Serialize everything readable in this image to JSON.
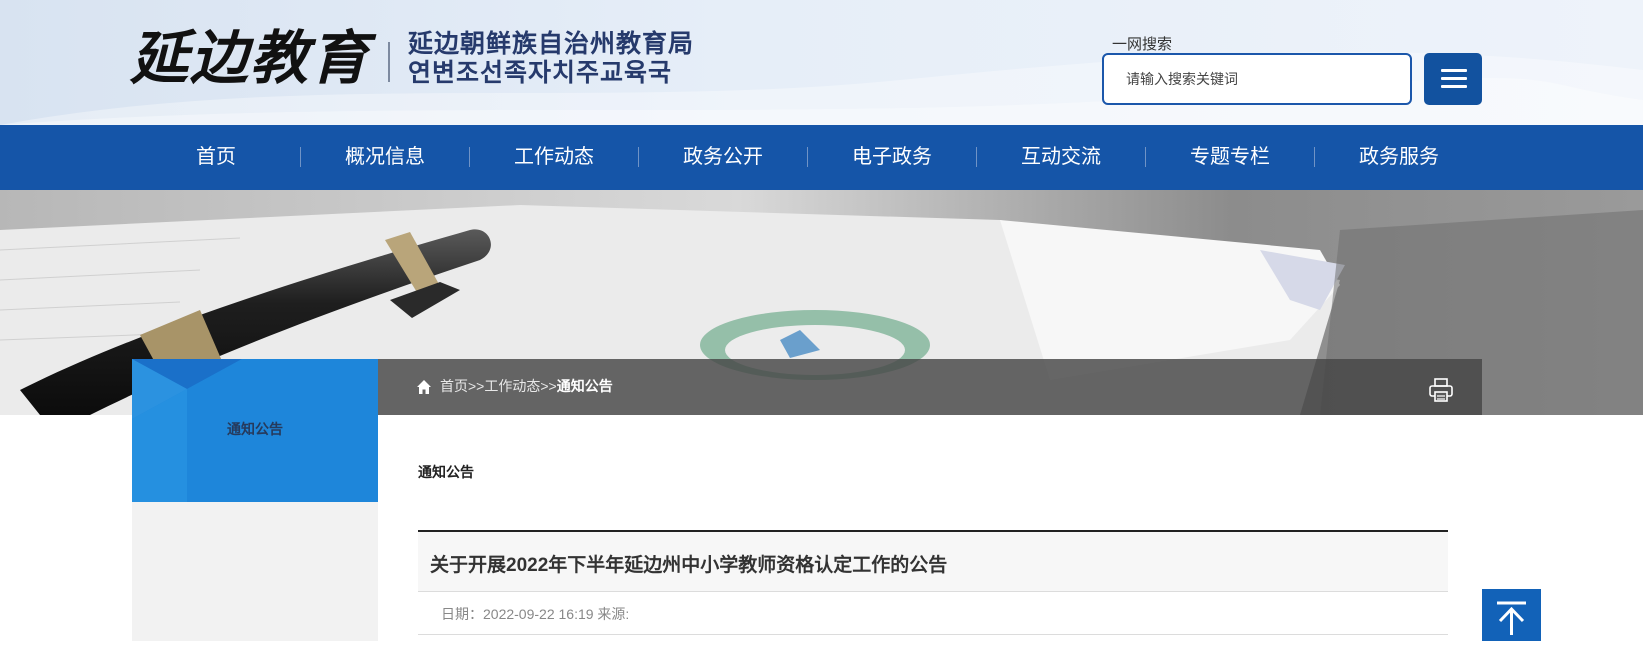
{
  "header": {
    "logo_calligraphy": "延边教育",
    "logo_org_cn": "延边朝鲜族自治州教育局",
    "logo_org_kr": "연변조선족자치주교육국",
    "search_label": "一网搜索",
    "search_placeholder": "请输入搜索关键词"
  },
  "nav": {
    "items": [
      {
        "label": "首页"
      },
      {
        "label": "概况信息"
      },
      {
        "label": "工作动态"
      },
      {
        "label": "政务公开"
      },
      {
        "label": "电子政务"
      },
      {
        "label": "互动交流"
      },
      {
        "label": "专题专栏"
      },
      {
        "label": "政务服务"
      }
    ]
  },
  "breadcrumb": {
    "home": "首页",
    "sep1": ">>",
    "level2": "工作动态",
    "sep2": ">>",
    "current": "通知公告"
  },
  "sidebar": {
    "title": "通知公告"
  },
  "content": {
    "section_title": "通知公告",
    "article_title": "关于开展2022年下半年延边州中小学教师资格认定工作的公告",
    "meta": "日期：2022-09-22 16:19 来源:"
  },
  "colors": {
    "nav_blue": "#1555a8",
    "side_blue": "#1e86da",
    "top_button": "#1262b8"
  },
  "icons": {
    "menu": "hamburger-icon",
    "home": "home-icon",
    "print": "printer-icon",
    "back_to_top": "arrow-up-icon"
  }
}
